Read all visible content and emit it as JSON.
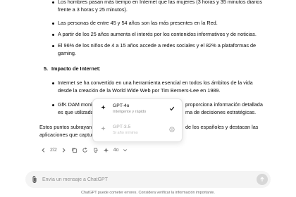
{
  "list": {
    "bullets_top": [
      "Los hombres pasan más tiempo en Internet que las mujeres (3 horas y 35 minutos diarios",
      "frente a 3 horas y 25 minutos).",
      "Las personas de entre 45 y 54 años son las más presentes en la Red.",
      "A partir de los 25 años aumenta el interés por los contenidos informativos y de noticias.",
      "El 96% de los niños de 4 a 15 años accede a redes sociales y el 82% a plataformas de",
      "gaming."
    ],
    "section5_number": "5.",
    "section5_title": "Impacto de Internet:",
    "bullets_section5": [
      "Internet se ha convertido en una herramienta esencial en todos los ámbitos de la vida",
      "desde la creación de la World Wide Web por Tim Berners-Lee en 1989.",
      "GfK DAM moni",
      "es que utilizada",
      "proporciona información detallada",
      "ma de decisiones estratégicas."
    ],
    "summary_line1_start": "Estos puntos subrayan l",
    "summary_line1_end": "de los españoles y destacan las",
    "summary_line2_start": "aplicaciones que captur"
  },
  "actions": {
    "pager": "2/2",
    "model_label": "4o"
  },
  "dropdown": {
    "items": [
      {
        "name": "GPT-4o",
        "desc": "Inteligente y rápido",
        "selected": true
      },
      {
        "name": "GPT-3.5",
        "desc": "Si año mínimo",
        "selected": false
      }
    ]
  },
  "composer": {
    "placeholder": "Envía un mensaje a ChatGPT"
  },
  "footer": {
    "disclaimer": "ChatGPT puede cometer errores. Considera verificar la información importante."
  },
  "colors": {
    "accent": "#0d0d0d",
    "muted": "#6b6b6b",
    "composer_bg": "#f4f4f4"
  }
}
